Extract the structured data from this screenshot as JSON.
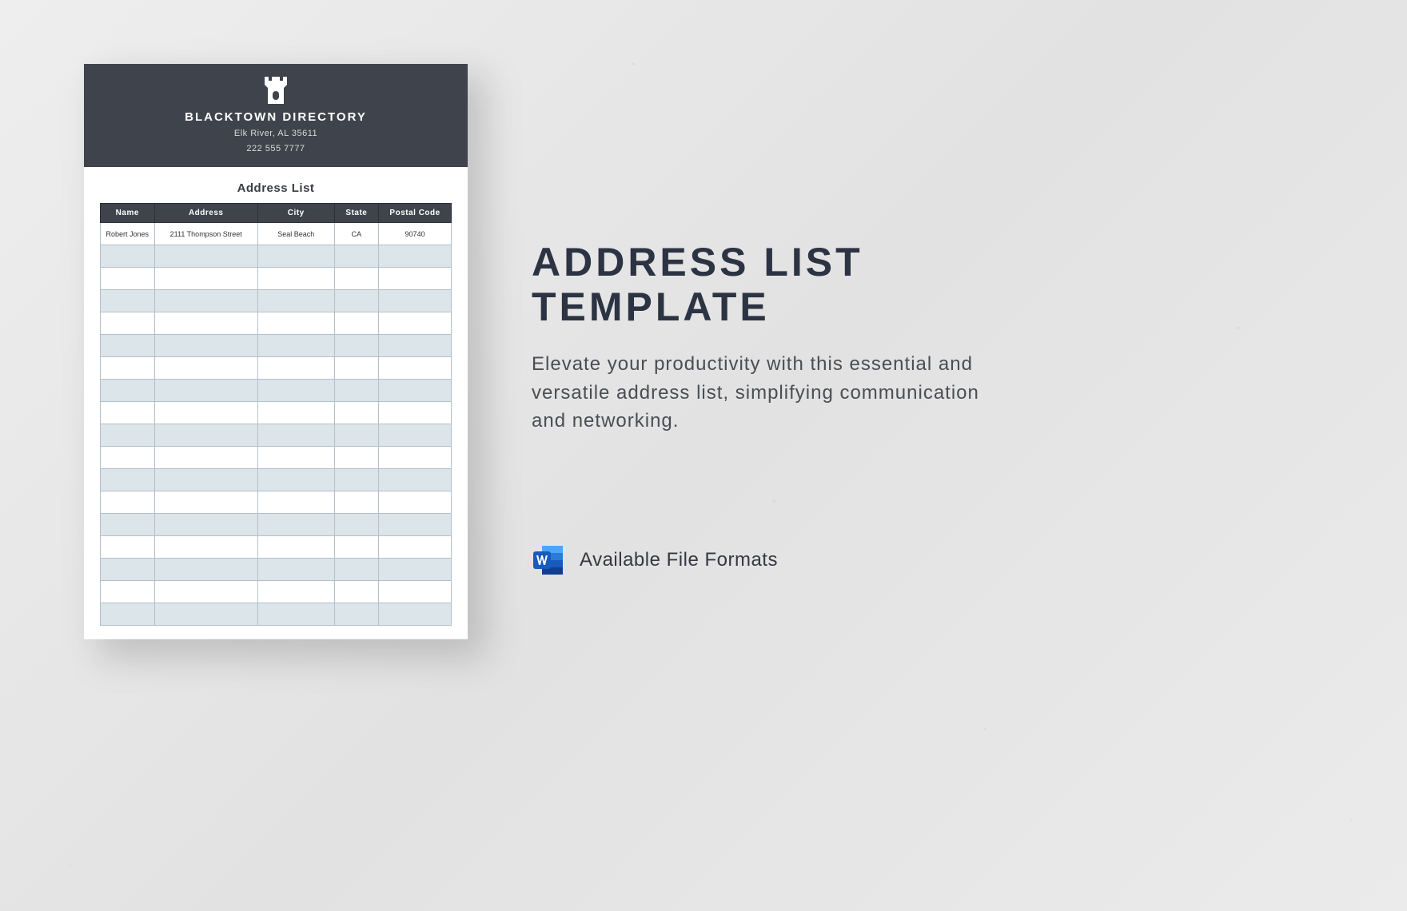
{
  "document": {
    "org_name": "BLACKTOWN DIRECTORY",
    "org_address": "Elk River, AL 35611",
    "org_phone": "222 555 7777",
    "list_title": "Address List",
    "columns": [
      "Name",
      "Address",
      "City",
      "State",
      "Postal Code"
    ],
    "rows": [
      {
        "name": "Robert Jones",
        "address": "2111 Thompson Street",
        "city": "Seal Beach",
        "state": "CA",
        "postal": "90740"
      }
    ],
    "blank_rows": 17
  },
  "promo": {
    "title_line1": "ADDRESS LIST",
    "title_line2": "TEMPLATE",
    "description": "Elevate your productivity with this essential and versatile address list, simplifying communication and networking."
  },
  "formats": {
    "label": "Available File Formats"
  },
  "colors": {
    "header_bg": "#3f434c",
    "row_alt": "#dbe5ea",
    "title": "#2c3443"
  }
}
